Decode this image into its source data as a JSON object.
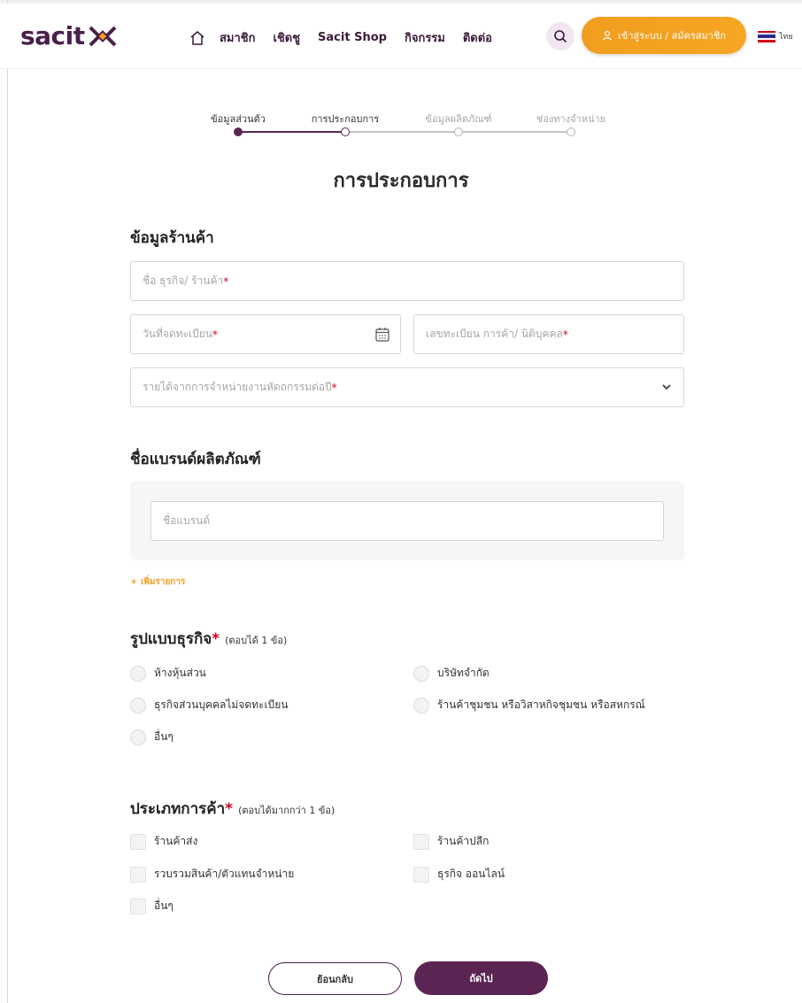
{
  "header": {
    "logo_text": "sacit",
    "nav": [
      "สมาชิก",
      "เชิดชู",
      "Sacit Shop",
      "กิจกรรม",
      "ติดต่อ"
    ],
    "login_label": "เข้าสู่ระบบ / สมัครสมาชิก",
    "language": "ไทย"
  },
  "stepper": {
    "steps": [
      {
        "label": "ข้อมูลส่วนตัว",
        "state": "done"
      },
      {
        "label": "การประกอบการ",
        "state": "current"
      },
      {
        "label": "ข้อมูลผลิตภัณฑ์",
        "state": "todo"
      },
      {
        "label": "ช่องทางจำหน่าย",
        "state": "todo"
      }
    ]
  },
  "page_title": "การประกอบการ",
  "shop_section": {
    "title": "ข้อมูลร้านค้า",
    "business_name": {
      "placeholder": "ชื่อ ธุรกิจ/ ร้านค้า",
      "required": "*"
    },
    "registration_date": {
      "placeholder": "วันที่จดทะเบียน",
      "required": "*"
    },
    "registration_number": {
      "placeholder": "เลขทะเบียน การค้า/ นิติบุคคล",
      "required": "*"
    },
    "annual_income": {
      "placeholder": "รายได้จากการจำหน่ายงานหัตถกรรมต่อปี",
      "required": "*"
    }
  },
  "brand_section": {
    "title": "ชื่อแบรนด์ผลิตภัณฑ์",
    "brand_placeholder": "ชื่อแบรนด์",
    "add_item": "+ เพิ่มรายการ"
  },
  "business_type": {
    "title": "รูปแบบธุรกิจ",
    "required": "*",
    "hint": "(ตอบได้ 1 ข้อ)",
    "options": [
      "ห้างหุ้นส่วน",
      "บริษัทจำกัด",
      "ธุรกิจส่วนบุคคลไม่จดทะเบียน",
      "ร้านค้าชุมชน หรือวิสาหกิจชุมชน หรือสหกรณ์",
      "อื่นๆ"
    ]
  },
  "trade_type": {
    "title": "ประเภทการค้า",
    "required": "*",
    "hint": "(ตอบได้มากกว่า 1 ข้อ)",
    "options": [
      "ร้านค้าส่ง",
      "ร้านค้าปลีก",
      "รวบรวมสินค้า/ตัวแทนจำหน่าย",
      "ธุรกิจ ออนไลน์",
      "อื่นๆ"
    ]
  },
  "actions": {
    "back": "ย้อนกลับ",
    "next": "ถัดไป"
  },
  "colors": {
    "brand": "#5c2452",
    "accent": "#f29d1e",
    "required": "#d0021b"
  },
  "icons": [
    "sacit-logo-icon",
    "home-icon",
    "search-icon",
    "user-icon",
    "thai-flag-icon",
    "calendar-icon",
    "chevron-down-icon"
  ]
}
